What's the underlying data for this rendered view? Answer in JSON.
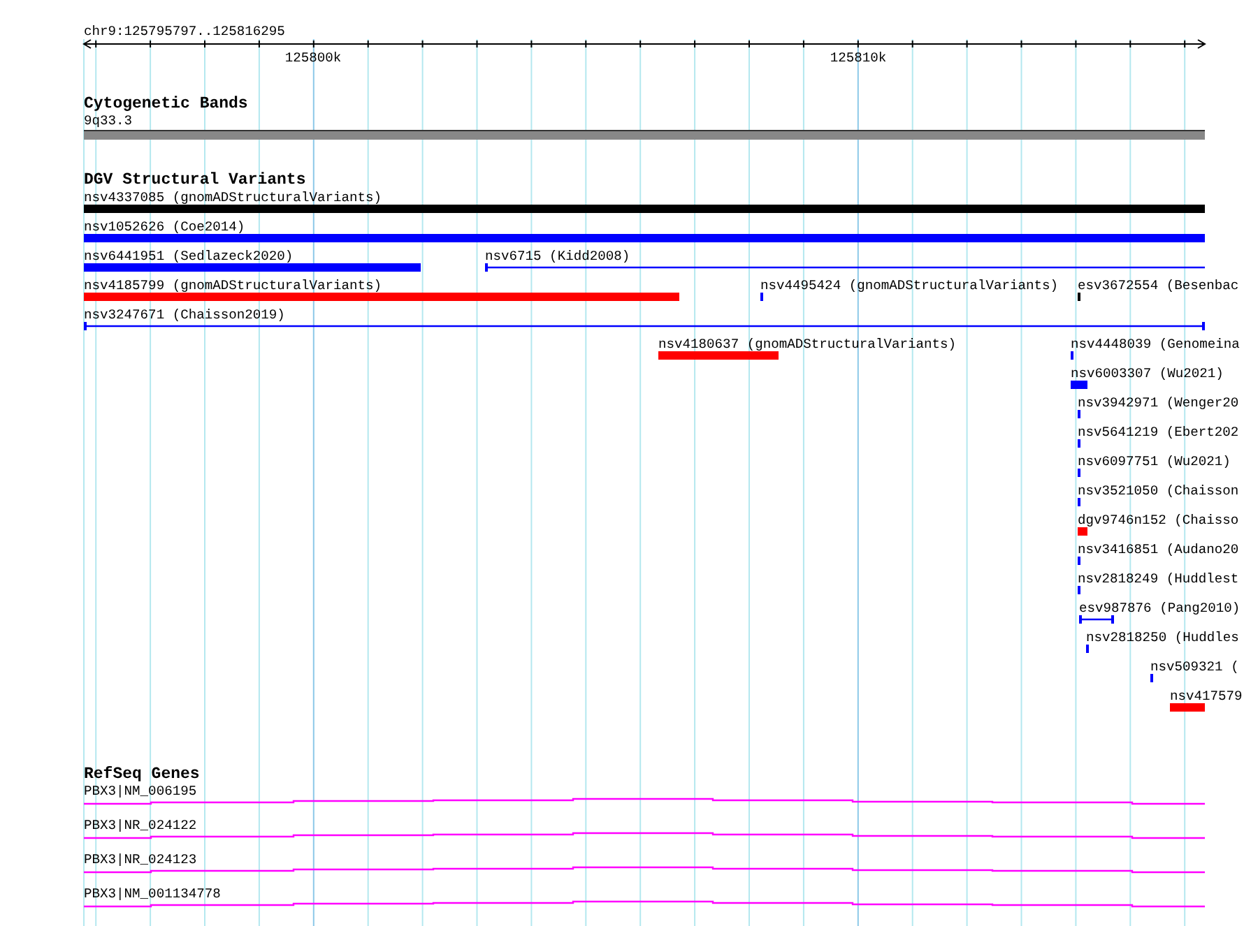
{
  "ruler": {
    "position": "chr9:125795797..125816295",
    "labels": [
      "125800k",
      "125810k"
    ]
  },
  "cytoband": {
    "title": "Cytogenetic Bands",
    "band": "9q33.3"
  },
  "dgv": {
    "title": "DGV Structural Variants",
    "rows": [
      {
        "features": [
          {
            "label": "nsv4337085 (gnomADStructuralVariants)",
            "color": "#000000",
            "kind": "bar"
          }
        ]
      },
      {
        "features": [
          {
            "label": "nsv1052626 (Coe2014)",
            "color": "#0000ff",
            "kind": "bar"
          }
        ]
      },
      {
        "features": [
          {
            "label": "nsv6441951 (Sedlazeck2020)",
            "color": "#0000ff",
            "kind": "bar"
          },
          {
            "label": "nsv6715 (Kidd2008)",
            "color": "#0000ff",
            "kind": "line"
          }
        ]
      },
      {
        "features": [
          {
            "label": "nsv4185799 (gnomADStructuralVariants)",
            "color": "#ff0000",
            "kind": "bar"
          },
          {
            "label": "nsv4495424 (gnomADStructuralVariants)",
            "color": "#0000ff",
            "kind": "bar"
          },
          {
            "label": "esv3672554 (Besenbac",
            "color": "#000000",
            "kind": "bar"
          }
        ]
      },
      {
        "features": [
          {
            "label": "nsv3247671 (Chaisson2019)",
            "color": "#0000ff",
            "kind": "line"
          }
        ]
      },
      {
        "features": [
          {
            "label": "nsv4180637 (gnomADStructuralVariants)",
            "color": "#ff0000",
            "kind": "bar"
          },
          {
            "label": "nsv4448039 (Genomeina",
            "color": "#0000ff",
            "kind": "bar"
          }
        ]
      },
      {
        "features": [
          {
            "label": "nsv6003307 (Wu2021)",
            "color": "#0000ff",
            "kind": "bar"
          }
        ]
      },
      {
        "features": [
          {
            "label": "nsv3942971 (Wenger20",
            "color": "#0000ff",
            "kind": "bar"
          }
        ]
      },
      {
        "features": [
          {
            "label": "nsv5641219 (Ebert202",
            "color": "#0000ff",
            "kind": "bar"
          }
        ]
      },
      {
        "features": [
          {
            "label": "nsv6097751 (Wu2021)",
            "color": "#0000ff",
            "kind": "bar"
          }
        ]
      },
      {
        "features": [
          {
            "label": "nsv3521050 (Chaisson",
            "color": "#0000ff",
            "kind": "bar"
          }
        ]
      },
      {
        "features": [
          {
            "label": "dgv9746n152 (Chaisso",
            "color": "#ff0000",
            "kind": "bar"
          }
        ]
      },
      {
        "features": [
          {
            "label": "nsv3416851 (Audano20",
            "color": "#0000ff",
            "kind": "bar"
          }
        ]
      },
      {
        "features": [
          {
            "label": "nsv2818249 (Huddlest",
            "color": "#0000ff",
            "kind": "bar"
          }
        ]
      },
      {
        "features": [
          {
            "label": "esv987876 (Pang2010)",
            "color": "#0000ff",
            "kind": "line"
          }
        ]
      },
      {
        "features": [
          {
            "label": "nsv2818250 (Huddles",
            "color": "#0000ff",
            "kind": "bar"
          }
        ]
      },
      {
        "features": [
          {
            "label": "nsv509321 (",
            "color": "#0000ff",
            "kind": "bar"
          }
        ]
      },
      {
        "features": [
          {
            "label": "nsv417579",
            "color": "#ff0000",
            "kind": "bar"
          }
        ]
      }
    ]
  },
  "genes": {
    "title": "RefSeq Genes",
    "items": [
      {
        "label": "PBX3|NM_006195"
      },
      {
        "label": "PBX3|NR_024122"
      },
      {
        "label": "PBX3|NR_024123"
      },
      {
        "label": "PBX3|NM_001134778"
      }
    ]
  }
}
